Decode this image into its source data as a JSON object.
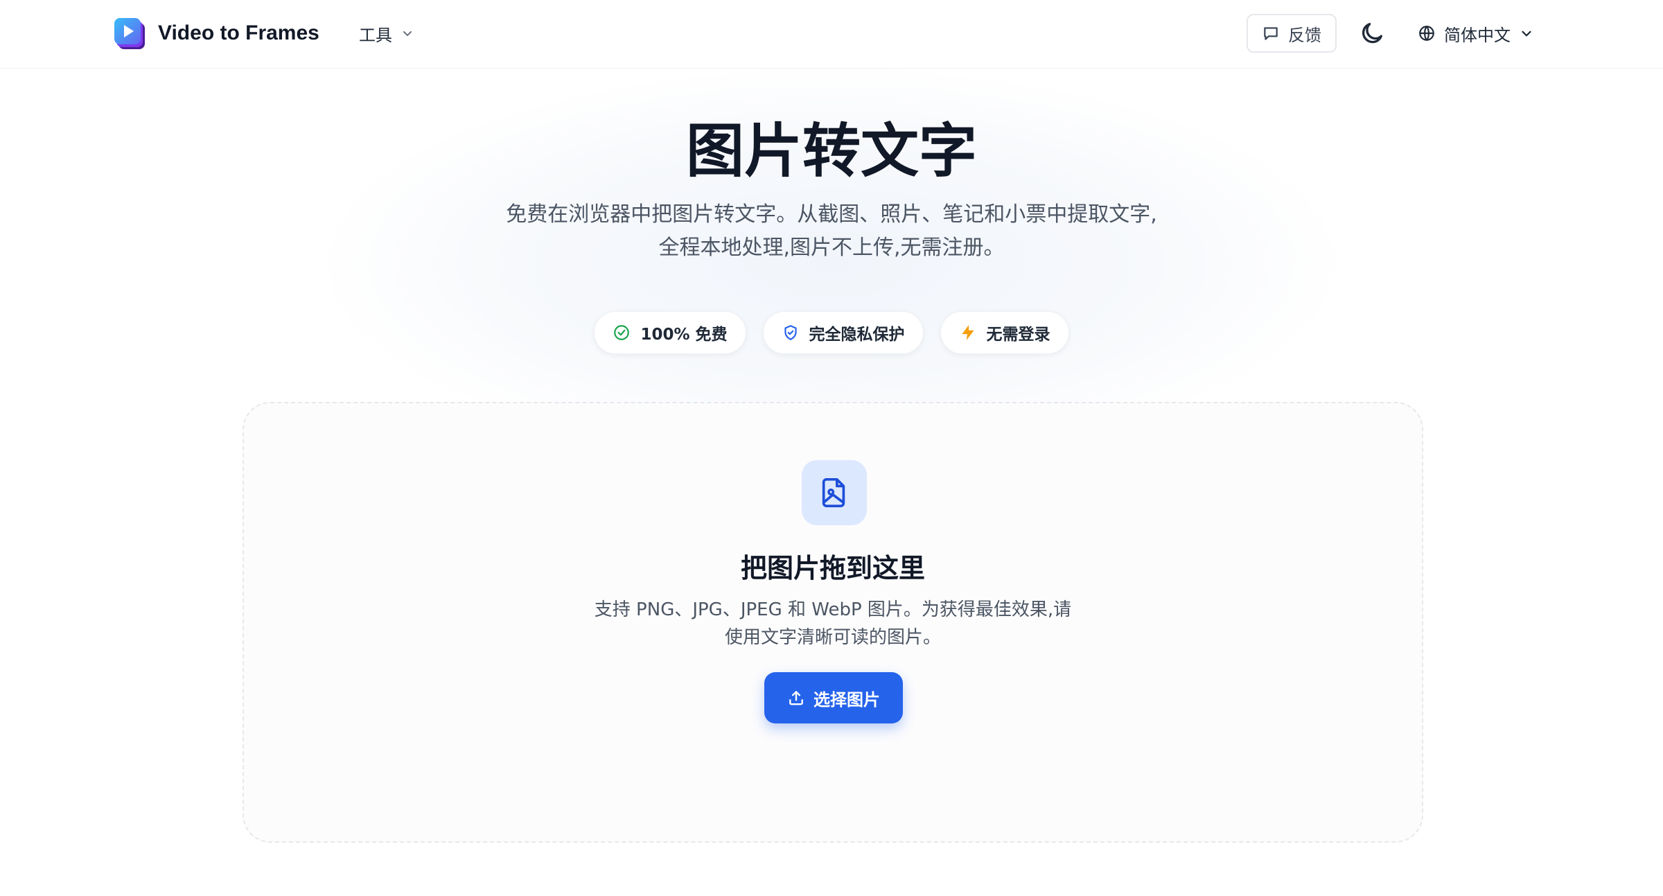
{
  "header": {
    "brand": "Video to Frames",
    "tools_label": "工具",
    "feedback_label": "反馈",
    "language_label": "简体中文"
  },
  "hero": {
    "title": "图片转文字",
    "subtitle_line1": "免费在浏览器中把图片转文字。从截图、照片、笔记和小票中提取文字,",
    "subtitle_line2": "全程本地处理,图片不上传,无需注册。",
    "badges": [
      {
        "label": "100% 免费",
        "icon": "check-circle-icon",
        "color": "#16a34a"
      },
      {
        "label": "完全隐私保护",
        "icon": "shield-icon",
        "color": "#2563eb"
      },
      {
        "label": "无需登录",
        "icon": "lightning-icon",
        "color": "#f59e0b"
      }
    ]
  },
  "dropzone": {
    "title": "把图片拖到这里",
    "desc_line1": "支持 PNG、JPG、JPEG 和 WebP 图片。为获得最佳效果,请",
    "desc_line2": "使用文字清晰可读的图片。",
    "button_label": "选择图片",
    "icon": "image-file-icon"
  },
  "colors": {
    "accent": "#2563eb",
    "icon_bg": "#dce8fd"
  }
}
